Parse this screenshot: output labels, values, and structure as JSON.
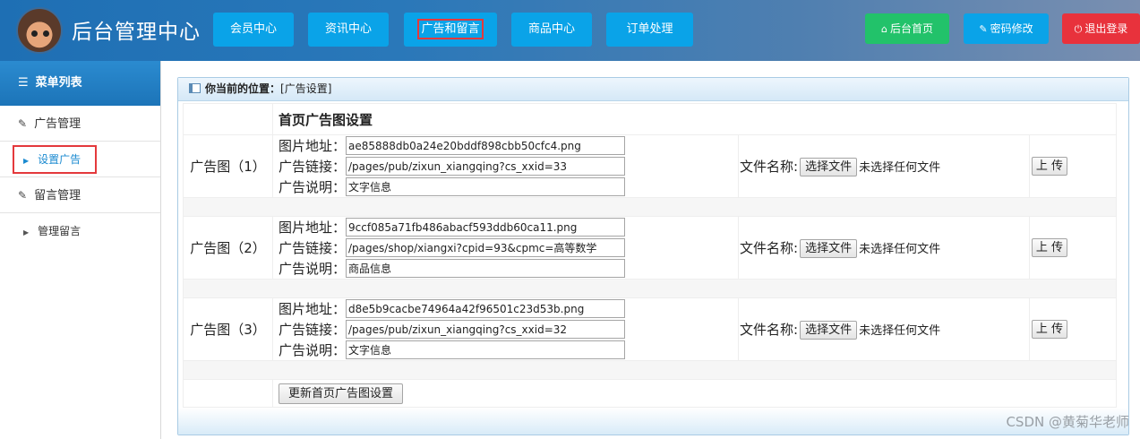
{
  "header": {
    "title": "后台管理中心",
    "nav": [
      {
        "label": "会员中心"
      },
      {
        "label": "资讯中心"
      },
      {
        "label": "广告和留言"
      },
      {
        "label": "商品中心"
      },
      {
        "label": "订单处理"
      }
    ],
    "home_label": "后台首页",
    "password_label": "密码修改",
    "logout_label": "退出登录"
  },
  "sidebar": {
    "heading": "菜单列表",
    "ad_manage": "广告管理",
    "set_ad": "设置广告",
    "msg_manage": "留言管理",
    "manage_msg": "管理留言"
  },
  "breadcrumb": {
    "prefix": "你当前的位置：",
    "current": "[广告设置]"
  },
  "form": {
    "caption": "首页广告图设置",
    "image_label": "图片地址：",
    "link_label": "广告链接：",
    "desc_label": "广告说明：",
    "file_label": "文件名称:",
    "choose_label": "选择文件",
    "no_file": "未选择任何文件",
    "upload_label": "上 传",
    "submit_label": "更新首页广告图设置",
    "ads": [
      {
        "label": "广告图（1）",
        "image": "ae85888db0a24e20bddf898cbb50cfc4.png",
        "link": "/pages/pub/zixun_xiangqing?cs_xxid=33",
        "desc": "文字信息"
      },
      {
        "label": "广告图（2）",
        "image": "9ccf085a71fb486abacf593ddb60ca11.png",
        "link": "/pages/shop/xiangxi?cpid=93&cpmc=高等数学",
        "desc": "商品信息"
      },
      {
        "label": "广告图（3）",
        "image": "d8e5b9cacbe74964a42f96501c23d53b.png",
        "link": "/pages/pub/zixun_xiangqing?cs_xxid=32",
        "desc": "文字信息"
      }
    ]
  },
  "watermark": "CSDN @黄菊华老师",
  "colors": {
    "nav_button": "#0aa3e8",
    "home_button": "#22c26a",
    "password_button": "#0aa3e8",
    "logout_button": "#e8323c",
    "highlight_border": "#e4393c"
  }
}
